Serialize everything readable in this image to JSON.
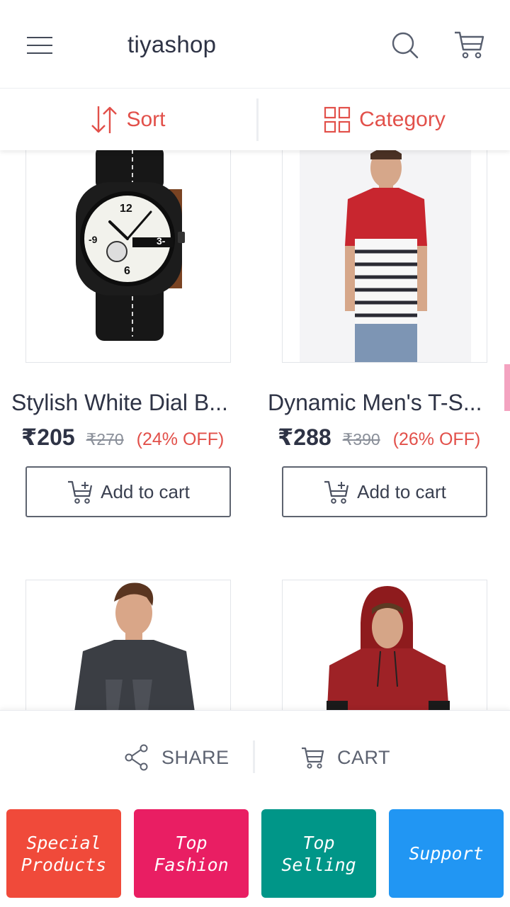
{
  "app": {
    "title": "tiyashop"
  },
  "filter": {
    "sort_label": "Sort",
    "category_label": "Category"
  },
  "products": [
    {
      "name": "Stylish White Dial B...",
      "price": "₹205",
      "mrp": "₹270",
      "discount": "(24% OFF)",
      "add_label": "Add to cart",
      "image": "watch"
    },
    {
      "name": "Dynamic Men's T-S...",
      "price": "₹288",
      "mrp": "₹390",
      "discount": "(26% OFF)",
      "add_label": "Add to cart",
      "image": "striped-tshirt"
    },
    {
      "image": "grey-sweatshirt"
    },
    {
      "image": "hoodie"
    }
  ],
  "actions": {
    "share_label": "SHARE",
    "cart_label": "CART"
  },
  "tiles": [
    {
      "label": "Special\nProducts",
      "color": "#f04a3a"
    },
    {
      "label": "Top\nFashion",
      "color": "#e91e63"
    },
    {
      "label": "Top\nSelling",
      "color": "#009688"
    },
    {
      "label": "Support",
      "color": "#2196f3"
    }
  ],
  "colors": {
    "accent": "#e2504a",
    "text": "#2e3345",
    "muted": "#8a8f99"
  }
}
